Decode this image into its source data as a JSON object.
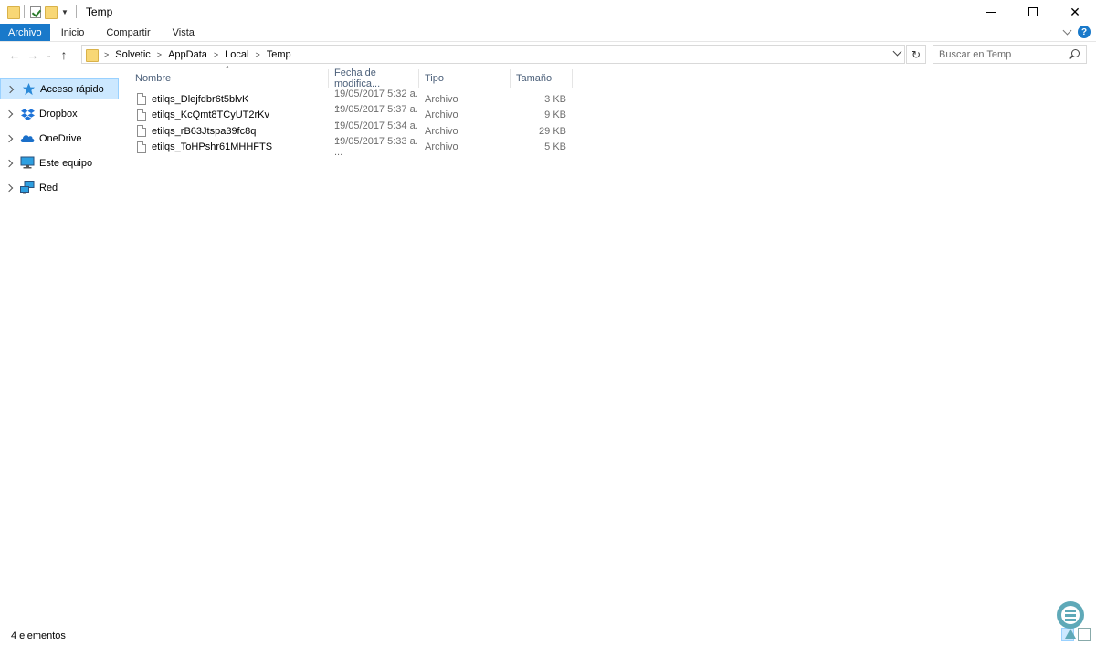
{
  "window": {
    "title": "Temp",
    "controls": {
      "minimize": "minimize",
      "maximize": "maximize",
      "close": "✕"
    }
  },
  "ribbon": {
    "tabs": [
      "Archivo",
      "Inicio",
      "Compartir",
      "Vista"
    ],
    "help": "?"
  },
  "address": {
    "crumbs": [
      "Solvetic",
      "AppData",
      "Local",
      "Temp"
    ],
    "search_placeholder": "Buscar en Temp"
  },
  "nav_pane": {
    "items": [
      {
        "label": "Acceso rápido",
        "icon": "star-icon",
        "selected": true
      },
      {
        "label": "Dropbox",
        "icon": "dropbox-icon"
      },
      {
        "label": "OneDrive",
        "icon": "onedrive-icon"
      },
      {
        "label": "Este equipo",
        "icon": "computer-icon"
      },
      {
        "label": "Red",
        "icon": "network-icon"
      }
    ]
  },
  "columns": {
    "name": "Nombre",
    "date": "Fecha de modifica...",
    "type": "Tipo",
    "size": "Tamaño"
  },
  "files": [
    {
      "name": "etilqs_Dlejfdbr6t5blvK",
      "date": "19/05/2017 5:32 a. ...",
      "type": "Archivo",
      "size": "3 KB"
    },
    {
      "name": "etilqs_KcQmt8TCyUT2rKv",
      "date": "19/05/2017 5:37 a. ...",
      "type": "Archivo",
      "size": "9 KB"
    },
    {
      "name": "etilqs_rB63Jtspa39fc8q",
      "date": "19/05/2017 5:34 a. ...",
      "type": "Archivo",
      "size": "29 KB"
    },
    {
      "name": "etilqs_ToHPshr61MHHFTS",
      "date": "19/05/2017 5:33 a. ...",
      "type": "Archivo",
      "size": "5 KB"
    }
  ],
  "status": {
    "count": "4 elementos"
  },
  "colors": {
    "accent": "#1979ca",
    "selection": "#cce8ff",
    "folder": "#f8d775"
  }
}
